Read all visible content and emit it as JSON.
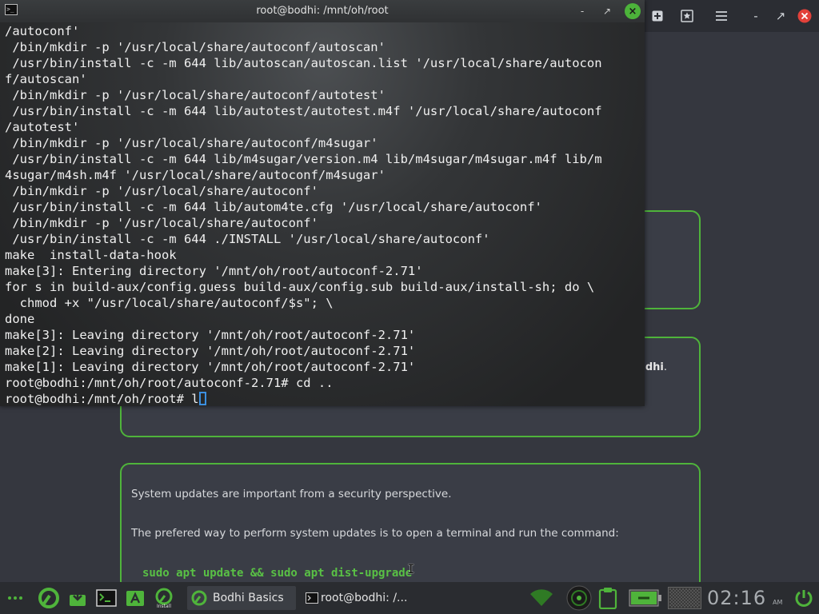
{
  "terminal": {
    "title": "root@bodhi: /mnt/oh/root",
    "lines": [
      "/autoconf'",
      " /bin/mkdir -p '/usr/local/share/autoconf/autoscan'",
      " /usr/bin/install -c -m 644 lib/autoscan/autoscan.list '/usr/local/share/autocon",
      "f/autoscan'",
      " /bin/mkdir -p '/usr/local/share/autoconf/autotest'",
      " /usr/bin/install -c -m 644 lib/autotest/autotest.m4f '/usr/local/share/autoconf",
      "/autotest'",
      " /bin/mkdir -p '/usr/local/share/autoconf/m4sugar'",
      " /usr/bin/install -c -m 644 lib/m4sugar/version.m4 lib/m4sugar/m4sugar.m4f lib/m",
      "4sugar/m4sh.m4f '/usr/local/share/autoconf/m4sugar'",
      " /bin/mkdir -p '/usr/local/share/autoconf'",
      " /usr/bin/install -c -m 644 lib/autom4te.cfg '/usr/local/share/autoconf'",
      " /bin/mkdir -p '/usr/local/share/autoconf'",
      " /usr/bin/install -c -m 644 ./INSTALL '/usr/local/share/autoconf'",
      "make  install-data-hook",
      "make[3]: Entering directory '/mnt/oh/root/autoconf-2.71'",
      "for s in build-aux/config.guess build-aux/config.sub build-aux/install-sh; do \\",
      "  chmod +x \"/usr/local/share/autoconf/$s\"; \\",
      "done",
      "make[3]: Leaving directory '/mnt/oh/root/autoconf-2.71'",
      "make[2]: Leaving directory '/mnt/oh/root/autoconf-2.71'",
      "make[1]: Leaving directory '/mnt/oh/root/autoconf-2.71'",
      "root@bodhi:/mnt/oh/root/autoconf-2.71# cd ..",
      "root@bodhi:/mnt/oh/root# l"
    ],
    "buttons": {
      "minimize": "-",
      "maximize": "↗",
      "close": "×"
    }
  },
  "browser": {
    "toolbar": {
      "add_tab": "+",
      "bookmark_icon": "star-icon",
      "menu_icon": "hamburger-icon",
      "minimize": "-",
      "maximize": "↗",
      "close": "×"
    },
    "card2_text_prefix": "dhi",
    "card2_text_suffix": ".",
    "card3": {
      "paragraph1": "System updates are important from a security perspective.",
      "paragraph2": "The prefered way to perform system updates is to open a terminal and run the command:",
      "command": "sudo apt update && sudo apt dist-upgrade"
    }
  },
  "taskbar": {
    "launchers": [
      "ellipsis-icon",
      "bodhi-start-icon",
      "download-icon",
      "terminal-icon",
      "app-install-icon",
      "install-bodhi-icon"
    ],
    "install_label": "Install",
    "tasks": [
      {
        "label": "Bodhi Basics",
        "active": true
      },
      {
        "label": "root@bodhi: /...",
        "active": false
      }
    ],
    "clock": "02:16",
    "clock_suffix": "AM"
  },
  "colors": {
    "accent": "#4fb43b",
    "terminal_bg": "#2d2f31",
    "page_bg": "#35373f",
    "cursor": "#3b8fe0"
  }
}
